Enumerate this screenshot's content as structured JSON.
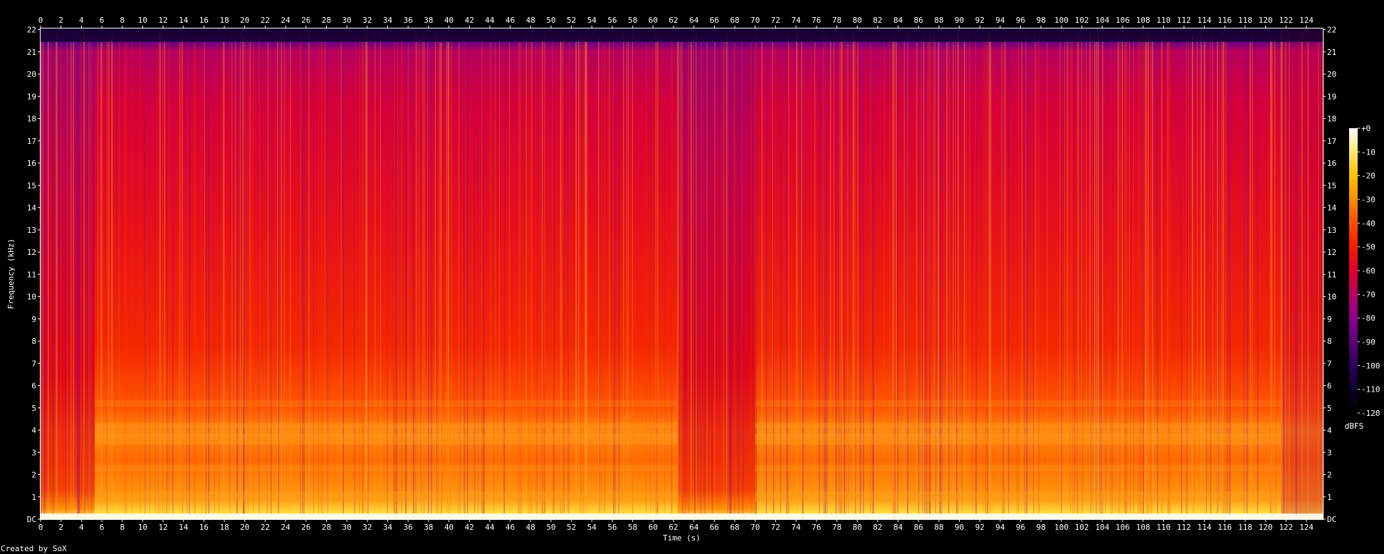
{
  "credit": "Created by SoX",
  "chart_data": {
    "type": "heatmap",
    "title": "",
    "xlabel": "Time (s)",
    "ylabel": "Frequency (kHz)",
    "xlim": [
      0,
      125.6
    ],
    "ylim": [
      0,
      22.05
    ],
    "x_ticks": [
      0,
      2,
      4,
      6,
      8,
      10,
      12,
      14,
      16,
      18,
      20,
      22,
      24,
      26,
      28,
      30,
      32,
      34,
      36,
      38,
      40,
      42,
      44,
      46,
      48,
      50,
      52,
      54,
      56,
      58,
      60,
      62,
      64,
      66,
      68,
      70,
      72,
      74,
      76,
      78,
      80,
      82,
      84,
      86,
      88,
      90,
      92,
      94,
      96,
      98,
      100,
      102,
      104,
      106,
      108,
      110,
      112,
      114,
      116,
      118,
      120,
      122,
      124
    ],
    "y_ticks": [
      "DC",
      "1",
      "2",
      "3",
      "4",
      "5",
      "6",
      "7",
      "8",
      "9",
      "10",
      "11",
      "12",
      "13",
      "14",
      "15",
      "16",
      "17",
      "18",
      "19",
      "20",
      "21",
      "22"
    ],
    "colorbar": {
      "label": "dBFS",
      "ticks": [
        "+0",
        "-10",
        "-20",
        "-30",
        "-40",
        "-50",
        "-60",
        "-70",
        "-80",
        "-90",
        "-100",
        "-110",
        "-120"
      ],
      "range": [
        -120,
        0
      ]
    },
    "colors": {
      "background": "#000000",
      "scale": [
        "#000000",
        "#0c0028",
        "#2d0058",
        "#5a007a",
        "#8a0090",
        "#b80060",
        "#e0002a",
        "#f01a00",
        "#ff5000",
        "#ff8c00",
        "#ffc000",
        "#ffe870",
        "#ffffff"
      ]
    },
    "description_series": [
      {
        "name": "overall level",
        "note": "broadband energy 0-21.5 kHz, brightest (yellow/white) below ~1 kHz, orange bands near 3.5-4.5 kHz, quieter sections 0-5 s and 63-70 s, fade near 122-125 s"
      }
    ]
  }
}
